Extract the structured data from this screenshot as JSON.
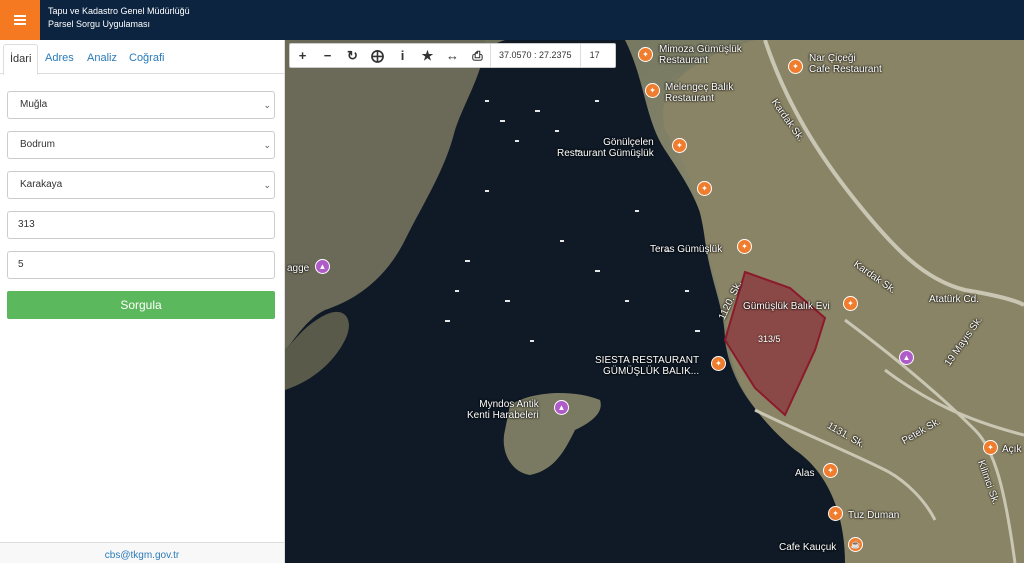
{
  "header": {
    "title_line1": "Tapu ve Kadastro Genel Müdürlüğü",
    "title_line2": "Parsel Sorgu Uygulaması"
  },
  "tabs": [
    {
      "label": "İdari"
    },
    {
      "label": "Adres"
    },
    {
      "label": "Analiz"
    },
    {
      "label": "Coğrafi"
    }
  ],
  "form": {
    "il": "Muğla",
    "ilce": "Bodrum",
    "mahalle": "Karakaya",
    "ada": "313",
    "parsel": "5",
    "submit_label": "Sorgula"
  },
  "footer": {
    "email": "cbs@tkgm.gov.tr"
  },
  "toolbar": {
    "icons": [
      "zoom-in-icon",
      "zoom-out-icon",
      "refresh-icon",
      "locate-icon",
      "info-icon",
      "bookmark-star-icon",
      "measure-icon",
      "print-icon"
    ],
    "coordinates": "37.0570 : 27.2375",
    "zoom_level": "17"
  },
  "map": {
    "parcel_label": "313/5",
    "places": [
      {
        "name": "Mimoza Gümüşlük\nRestaurant"
      },
      {
        "name": "Nar Çiçeği\nCafe Restaurant"
      },
      {
        "name": "Melengeç Balık\nRestaurant"
      },
      {
        "name": "Gönülçelen\nRestaurant Gümüşlük"
      },
      {
        "name": "Teras Gümüşlük"
      },
      {
        "name": "Gümüşlük Balık Evi"
      },
      {
        "name": "SIESTA RESTAURANT\nGÜMÜŞLÜK BALIK..."
      },
      {
        "name": "Myndos Antik\nKenti Harabeleri"
      },
      {
        "name": "agge"
      },
      {
        "name": "Alas"
      },
      {
        "name": "Tuz Duman"
      },
      {
        "name": "Cafe Kauçuk"
      },
      {
        "name": "Açık"
      }
    ],
    "roads": [
      "Kardak Sk.",
      "Kardak Sk.",
      "Atatürk Cd.",
      "19 Mayıs Sk.",
      "Petek Sk.",
      "Kilimci Sk.",
      "1131. Sk.",
      "1120. Sk."
    ],
    "colors": {
      "pin": "#f07d2e",
      "parcel": "#8b1a2b",
      "header": "#0c2440",
      "menu": "#f47920",
      "button": "#5cb85c"
    }
  }
}
